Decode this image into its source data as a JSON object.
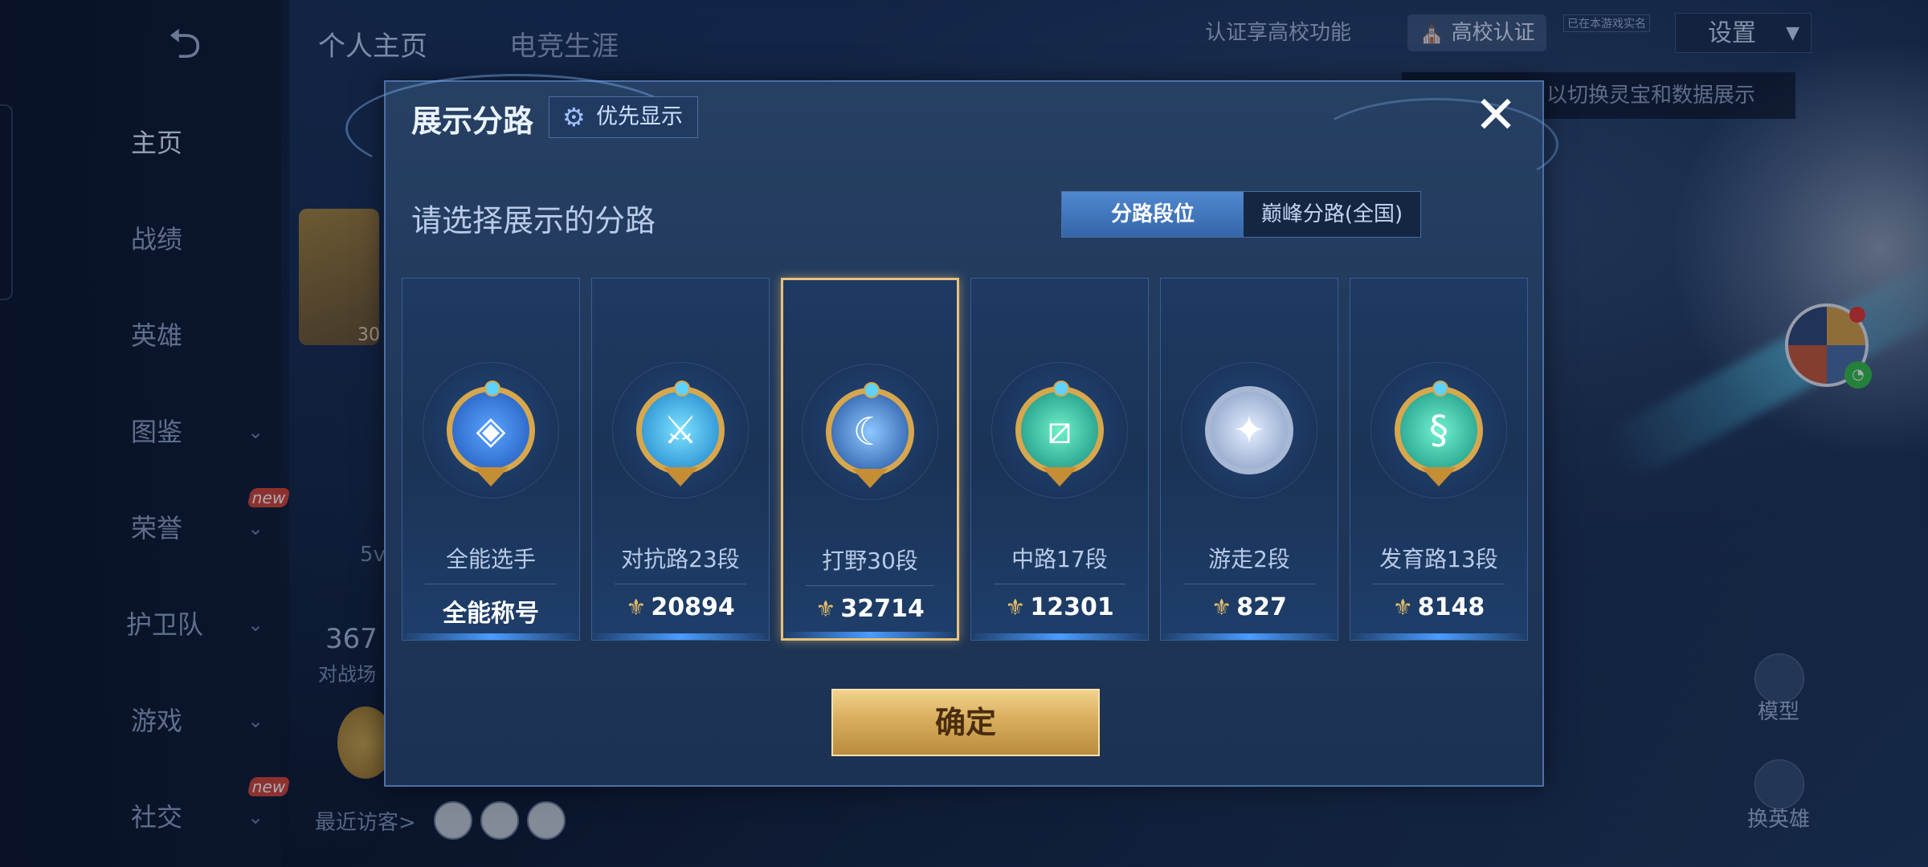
{
  "background": {
    "top_tabs": [
      "个人主页",
      "电竞生涯"
    ],
    "verify_text": "认证享高校功能",
    "campus_button": "高校认证",
    "tiny_tag": "已在本游戏实名",
    "settings_button": "设置",
    "hint_text": "以切换灵宝和数据展示",
    "sidenav": [
      {
        "label": "主页",
        "active": true
      },
      {
        "label": "战绩"
      },
      {
        "label": "英雄"
      },
      {
        "label": "图鉴"
      },
      {
        "label": "荣誉",
        "badge": "new"
      },
      {
        "label": "护卫队"
      },
      {
        "label": "游戏"
      },
      {
        "label": "社交",
        "badge": "new"
      }
    ],
    "level_num": "30",
    "stat_partial": "5v",
    "battle_count": "367",
    "battle_label": "对战场",
    "visitors_label": "最近访客>",
    "model_label": "模型",
    "change_hero_label": "换英雄"
  },
  "dialog": {
    "title": "展示分路",
    "priority_button": "优先显示",
    "prompt": "请选择展示的分路",
    "tabs": [
      "分路段位",
      "巅峰分路(全国)"
    ],
    "active_tab": 0,
    "selected_card": 2,
    "cards": [
      {
        "name": "全能选手",
        "value": "全能称号",
        "emblem": "allround",
        "show_icon": false
      },
      {
        "name": "对抗路23段",
        "value": "20894",
        "emblem": "clash",
        "show_icon": true
      },
      {
        "name": "打野30段",
        "value": "32714",
        "emblem": "jungle",
        "show_icon": true
      },
      {
        "name": "中路17段",
        "value": "12301",
        "emblem": "mid",
        "show_icon": true
      },
      {
        "name": "游走2段",
        "value": "827",
        "emblem": "roam",
        "show_icon": true
      },
      {
        "name": "发育路13段",
        "value": "8148",
        "emblem": "farm",
        "show_icon": true
      }
    ],
    "confirm_button": "确定"
  },
  "colors": {
    "accent_gold": "#e9c27a",
    "tab_active": "#3f79c2",
    "dialog_bg": "#1f3658"
  },
  "icons": {
    "back": "back-arrow-icon",
    "gear": "gear-icon",
    "close": "close-icon",
    "rank": "rank-crest-icon"
  }
}
